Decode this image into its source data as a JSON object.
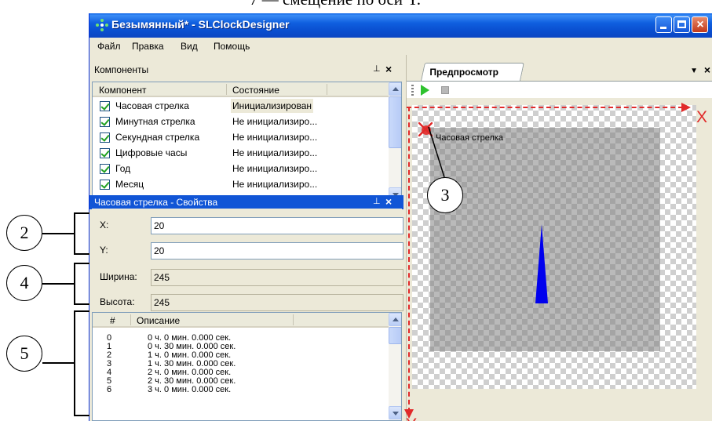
{
  "caption_top": "7 — смещение по оси Y.",
  "window": {
    "title": "Безымянный* - SLClockDesigner",
    "buttons": {
      "minimize": "minimize",
      "maximize": "maximize",
      "close": "×"
    }
  },
  "menu": [
    "Файл",
    "Правка",
    "Вид",
    "Помощь"
  ],
  "components_panel": {
    "title": "Компоненты",
    "columns": [
      "Компонент",
      "Состояние"
    ],
    "rows": [
      {
        "name": "Часовая стрелка",
        "state": "Инициализирован",
        "checked": true
      },
      {
        "name": "Минутная стрелка",
        "state": "Не инициализиро...",
        "checked": true
      },
      {
        "name": "Секундная стрелка",
        "state": "Не инициализиро...",
        "checked": true
      },
      {
        "name": "Цифровые часы",
        "state": "Не инициализиро...",
        "checked": true
      },
      {
        "name": "Год",
        "state": "Не инициализиро...",
        "checked": true
      },
      {
        "name": "Месяц",
        "state": "Не инициализиро...",
        "checked": true
      }
    ]
  },
  "properties_panel": {
    "title": "Часовая стрелка - Свойства",
    "x_label": "X:",
    "x_value": "20",
    "y_label": "Y:",
    "y_value": "20",
    "width_label": "Ширина:",
    "width_value": "245",
    "height_label": "Высота:",
    "height_value": "245"
  },
  "desc_list": {
    "columns": [
      "#",
      "Описание"
    ],
    "rows": [
      {
        "n": "0",
        "t": "0 ч.  0 мин.  0.000 сек."
      },
      {
        "n": "1",
        "t": "0 ч. 30 мин.  0.000 сек."
      },
      {
        "n": "2",
        "t": "1 ч.  0 мин.  0.000 сек."
      },
      {
        "n": "3",
        "t": "1 ч. 30 мин.  0.000 сек."
      },
      {
        "n": "4",
        "t": "2 ч.  0 мин.  0.000 сек."
      },
      {
        "n": "5",
        "t": "2 ч. 30 мин.  0.000 сек."
      },
      {
        "n": "6",
        "t": "3 ч.  0 мин.  0.000 сек."
      }
    ]
  },
  "preview": {
    "tab_label": "Предпросмотр",
    "hand_label": "Часовая стрелка",
    "axis_x": "X",
    "axis_y": "Y"
  },
  "callouts": {
    "c2": "2",
    "c3": "3",
    "c4": "4",
    "c5": "5"
  },
  "colors": {
    "titlebar": "#0a4fd0",
    "axis": "#e12a2a",
    "hand": "#0000ee",
    "panel_active": "#1155d6"
  }
}
